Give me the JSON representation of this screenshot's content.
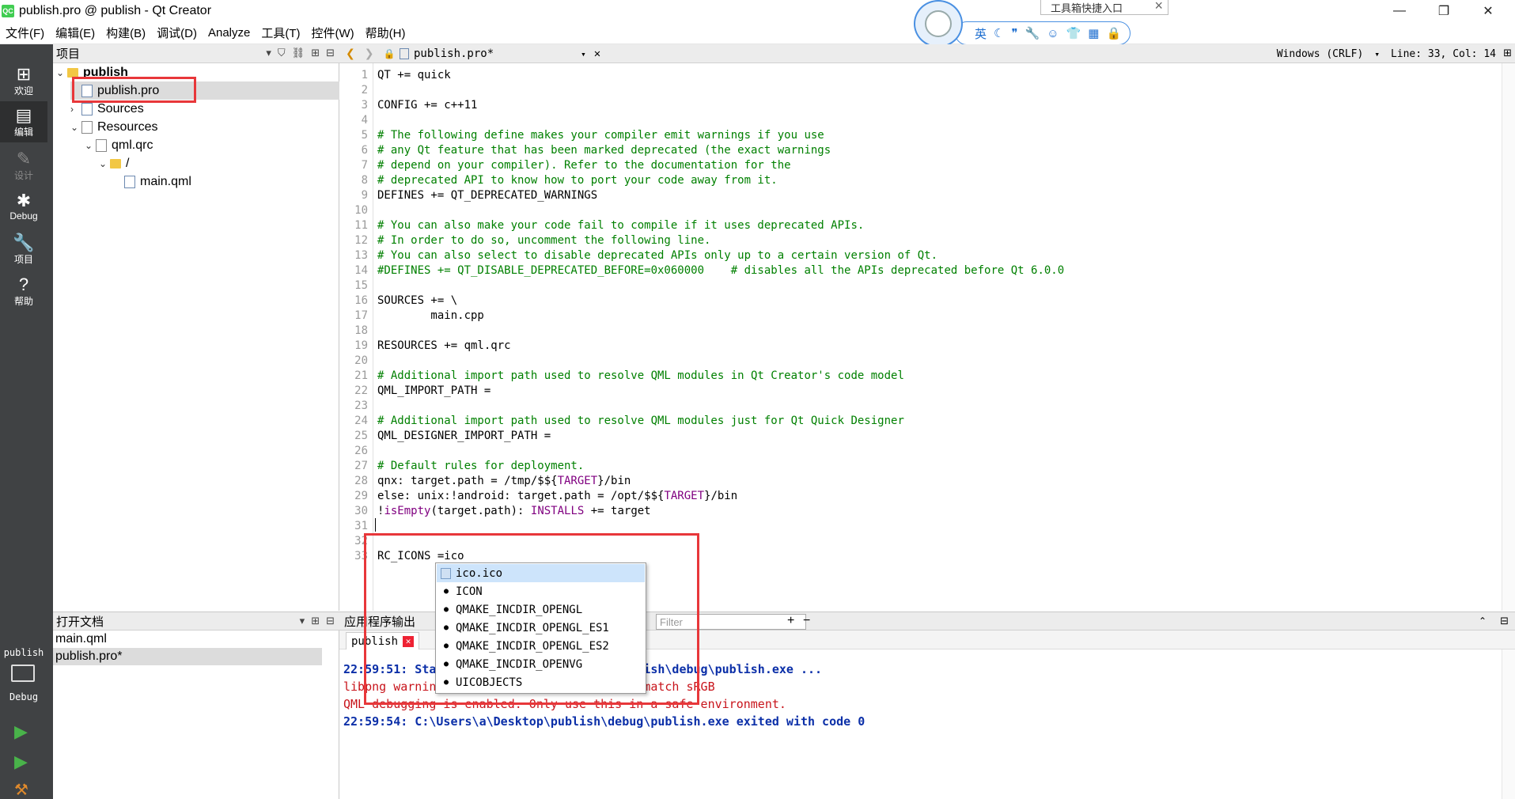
{
  "window": {
    "title": "publish.pro @ publish - Qt Creator",
    "logo": "QC",
    "min_icon": "—",
    "max_icon": "❐",
    "close_icon": "✕"
  },
  "menu": [
    "文件(F)",
    "编辑(E)",
    "构建(B)",
    "调试(D)",
    "Analyze",
    "工具(T)",
    "控件(W)",
    "帮助(H)"
  ],
  "ime": {
    "tooltip": "工具箱快捷入口",
    "lang": "英",
    "icons": [
      "moon-icon",
      "quote-icon",
      "wrench-icon",
      "smiley-icon",
      "shirt-icon",
      "grid-icon",
      "lock-icon"
    ]
  },
  "modes": [
    {
      "label": "欢迎",
      "icon": "⊞"
    },
    {
      "label": "编辑",
      "icon": "▤"
    },
    {
      "label": "设计",
      "icon": "✎"
    },
    {
      "label": "Debug",
      "icon": "✱"
    },
    {
      "label": "项目",
      "icon": "🔧"
    },
    {
      "label": "帮助",
      "icon": "?"
    }
  ],
  "run": {
    "kit_label": "publish",
    "build_label": "Debug"
  },
  "projects": {
    "header": "项目",
    "tree": [
      {
        "label": "publish",
        "depth": 0,
        "expanded": true,
        "type": "project"
      },
      {
        "label": "publish.pro",
        "depth": 1,
        "type": "pro",
        "selected": true
      },
      {
        "label": "Sources",
        "depth": 1,
        "expanded": false,
        "type": "sources"
      },
      {
        "label": "Resources",
        "depth": 1,
        "expanded": true,
        "type": "resources"
      },
      {
        "label": "qml.qrc",
        "depth": 2,
        "expanded": true,
        "type": "qrc"
      },
      {
        "label": "/",
        "depth": 3,
        "expanded": true,
        "type": "folder"
      },
      {
        "label": "main.qml",
        "depth": 4,
        "type": "qml"
      }
    ]
  },
  "open_docs": {
    "header": "打开文档",
    "items": [
      "main.qml",
      "publish.pro*"
    ],
    "selected": 1
  },
  "editor": {
    "tab": "publish.pro*",
    "line_ending": "Windows (CRLF)",
    "cursor": "Line: 33, Col: 14",
    "lines": [
      [
        {
          "t": "QT += quick",
          "k": "txt"
        }
      ],
      [],
      [
        {
          "t": "CONFIG += c++11",
          "k": "txt"
        }
      ],
      [],
      [
        {
          "t": "# The following define makes your compiler emit warnings if you use",
          "k": "com"
        }
      ],
      [
        {
          "t": "# any Qt feature that has been marked deprecated (the exact warnings",
          "k": "com"
        }
      ],
      [
        {
          "t": "# depend on your compiler). Refer to the documentation for the",
          "k": "com"
        }
      ],
      [
        {
          "t": "# deprecated API to know how to port your code away from it.",
          "k": "com"
        }
      ],
      [
        {
          "t": "DEFINES += QT_DEPRECATED_WARNINGS",
          "k": "txt"
        }
      ],
      [],
      [
        {
          "t": "# You can also make your code fail to compile if it uses deprecated APIs.",
          "k": "com"
        }
      ],
      [
        {
          "t": "# In order to do so, uncomment the following line.",
          "k": "com"
        }
      ],
      [
        {
          "t": "# You can also select to disable deprecated APIs only up to a certain version of Qt.",
          "k": "com"
        }
      ],
      [
        {
          "t": "#DEFINES += QT_DISABLE_DEPRECATED_BEFORE=0x060000    # disables all the APIs deprecated before Qt 6.0.0",
          "k": "com"
        }
      ],
      [],
      [
        {
          "t": "SOURCES += \\",
          "k": "txt"
        }
      ],
      [
        {
          "t": "        main.cpp",
          "k": "txt"
        }
      ],
      [],
      [
        {
          "t": "RESOURCES += qml.qrc",
          "k": "txt"
        }
      ],
      [],
      [
        {
          "t": "# Additional import path used to resolve QML modules in Qt Creator's code model",
          "k": "com"
        }
      ],
      [
        {
          "t": "QML_IMPORT_PATH =",
          "k": "txt"
        }
      ],
      [],
      [
        {
          "t": "# Additional import path used to resolve QML modules just for Qt Quick Designer",
          "k": "com"
        }
      ],
      [
        {
          "t": "QML_DESIGNER_IMPORT_PATH =",
          "k": "txt"
        }
      ],
      [],
      [
        {
          "t": "# Default rules for deployment.",
          "k": "com"
        }
      ],
      [
        {
          "t": "qnx: target.path = /tmp/$${",
          "k": "txt"
        },
        {
          "t": "TARGET",
          "k": "var"
        },
        {
          "t": "}/bin",
          "k": "txt"
        }
      ],
      [
        {
          "t": "else: unix:!android: target.path = /opt/$${",
          "k": "txt"
        },
        {
          "t": "TARGET",
          "k": "var"
        },
        {
          "t": "}/bin",
          "k": "txt"
        }
      ],
      [
        {
          "t": "!",
          "k": "txt"
        },
        {
          "t": "isEmpty",
          "k": "var"
        },
        {
          "t": "(target.path): ",
          "k": "txt"
        },
        {
          "t": "INSTALLS",
          "k": "var"
        },
        {
          "t": " += target",
          "k": "txt"
        }
      ],
      [],
      [],
      [
        {
          "t": "RC_ICONS =ico",
          "k": "txt"
        }
      ]
    ]
  },
  "completion": {
    "items": [
      "ico.ico",
      "ICON",
      "QMAKE_INCDIR_OPENGL",
      "QMAKE_INCDIR_OPENGL_ES1",
      "QMAKE_INCDIR_OPENGL_ES2",
      "QMAKE_INCDIR_OPENVG",
      "UICOBJECTS"
    ],
    "selected": 0
  },
  "output": {
    "header": "应用程序输出",
    "filter_placeholder": "Filter",
    "tab": "publish",
    "lines": [
      {
        "text": "22:59:51: Starting C:\\Users\\a\\Desktop\\publish\\debug\\publish.exe ...",
        "kind": "blue"
      },
      {
        "text": "libpng warning: iCCP: cHRM chunk does not match sRGB",
        "kind": "red"
      },
      {
        "text": "QML debugging is enabled. Only use this in a safe environment.",
        "kind": "red"
      },
      {
        "text": "22:59:54: C:\\Users\\a\\Desktop\\publish\\debug\\publish.exe exited with code 0",
        "kind": "blue"
      }
    ]
  },
  "colors": {
    "highlight": "#e8373a",
    "modebar": "#404244",
    "comment": "#008000",
    "keyword": "#800080"
  }
}
